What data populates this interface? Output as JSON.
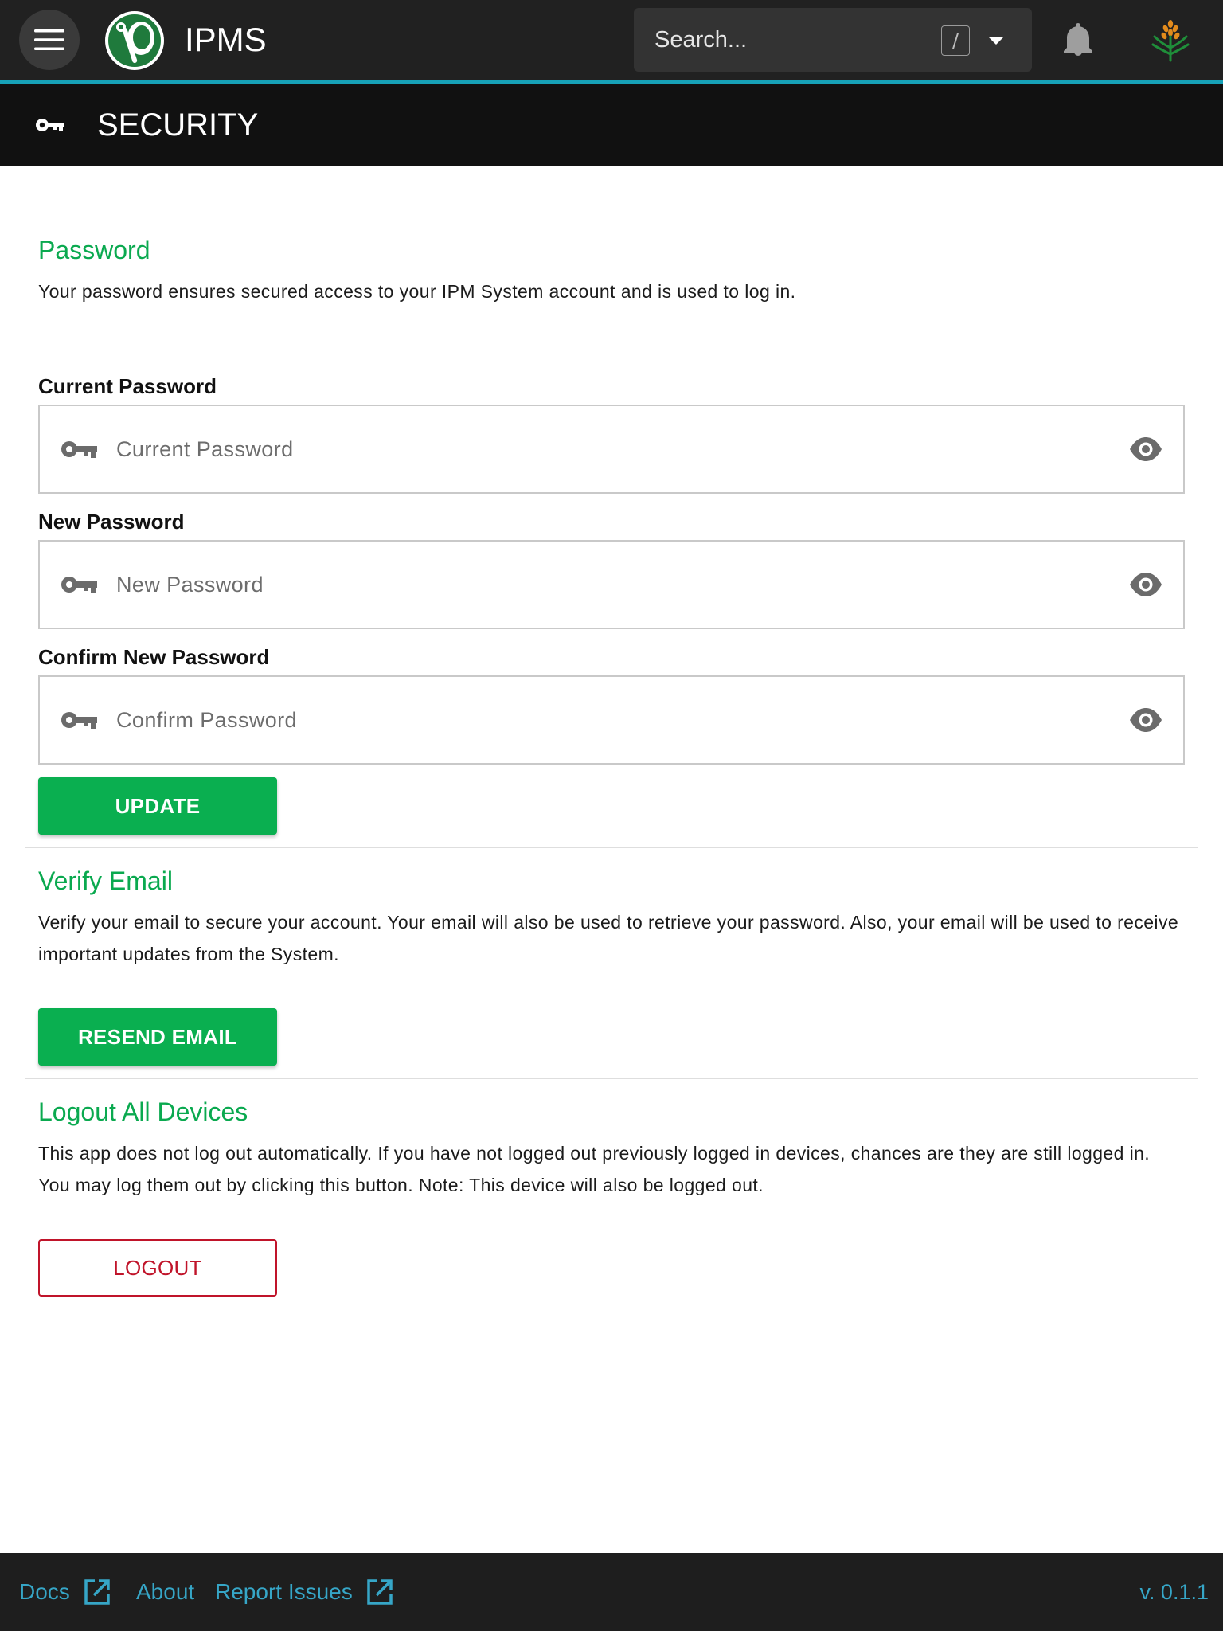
{
  "app": {
    "name": "IPMS",
    "accent_color": "#17a2b8",
    "brand_green": "#0aaf50",
    "danger_color": "#c0142a"
  },
  "topbar": {
    "menu_icon": "hamburger-menu-icon",
    "search": {
      "placeholder": "Search...",
      "shortcut_key": "/"
    },
    "notifications_icon": "bell-icon",
    "avatar_icon": "wheat-avatar-icon"
  },
  "page": {
    "icon": "key-icon",
    "title": "SECURITY"
  },
  "password_section": {
    "title": "Password",
    "description": "Your password ensures secured access to your IPM System account and is used to log in.",
    "fields": [
      {
        "label": "Current Password",
        "placeholder": "Current Password",
        "value": ""
      },
      {
        "label": "New Password",
        "placeholder": "New Password",
        "value": ""
      },
      {
        "label": "Confirm New Password",
        "placeholder": "Confirm Password",
        "value": ""
      }
    ],
    "update_button": "UPDATE"
  },
  "email_section": {
    "title": "Verify Email",
    "description": "Verify your email to secure your account. Your email will also be used to retrieve your password. Also, your email will be used to receive important updates from the System.",
    "resend_button": "RESEND EMAIL"
  },
  "logout_section": {
    "title": "Logout All Devices",
    "description": "This app does not log out automatically. If you have not logged out previously logged in devices, chances are they are still logged in. You may log them out by clicking this button. Note: This device will also be logged out.",
    "logout_button": "LOGOUT"
  },
  "footer": {
    "links": [
      {
        "label": "Docs",
        "external": true
      },
      {
        "label": "About",
        "external": false
      },
      {
        "label": "Report Issues",
        "external": true
      }
    ],
    "version": "v. 0.1.1"
  }
}
